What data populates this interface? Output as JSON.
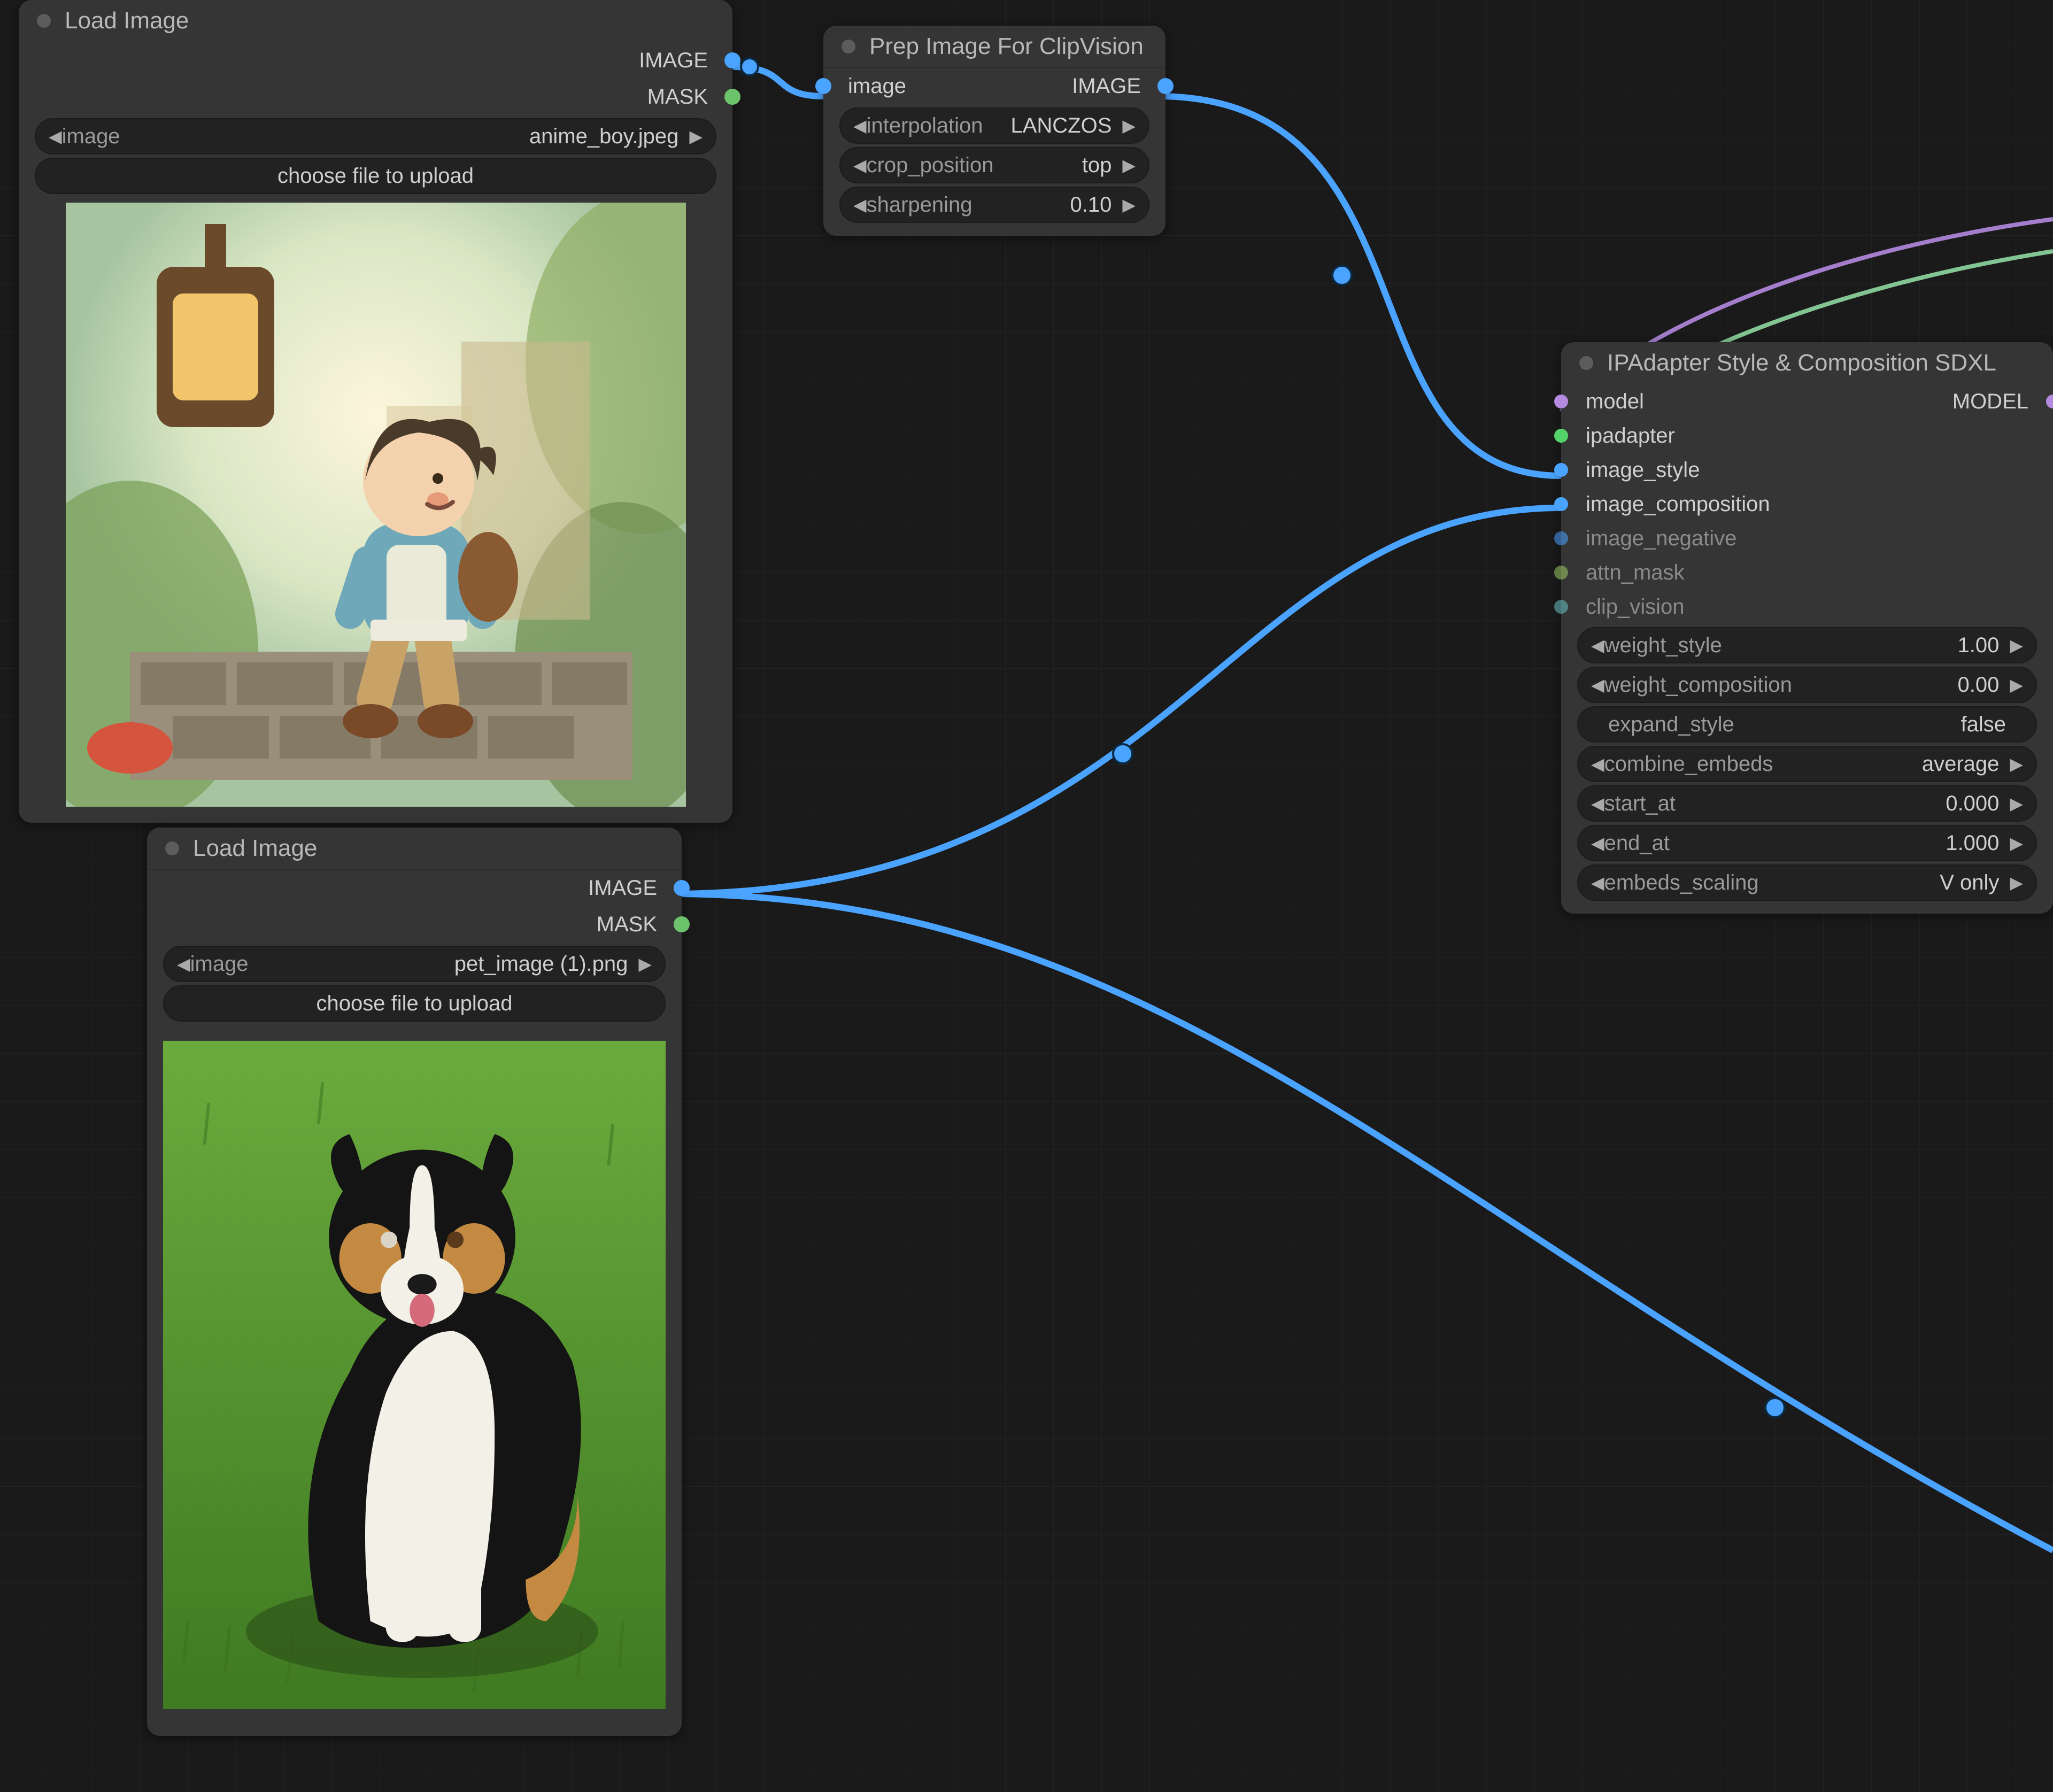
{
  "nodes": {
    "load1": {
      "title": "Load Image",
      "outputs": {
        "image": "IMAGE",
        "mask": "MASK"
      },
      "widgets": {
        "image_label": "image",
        "image_value": "anime_boy.jpeg",
        "upload": "choose file to upload"
      }
    },
    "load2": {
      "title": "Load Image",
      "outputs": {
        "image": "IMAGE",
        "mask": "MASK"
      },
      "widgets": {
        "image_label": "image",
        "image_value": "pet_image (1).png",
        "upload": "choose file to upload"
      }
    },
    "prep": {
      "title": "Prep Image For ClipVision",
      "in": {
        "image": "image"
      },
      "out": {
        "image": "IMAGE"
      },
      "widgets": {
        "interp_label": "interpolation",
        "interp_value": "LANCZOS",
        "crop_label": "crop_position",
        "crop_value": "top",
        "sharp_label": "sharpening",
        "sharp_value": "0.10"
      }
    },
    "ipa": {
      "title": "IPAdapter Style & Composition SDXL",
      "in": {
        "model": "model",
        "ipadapter": "ipadapter",
        "image_style": "image_style",
        "image_composition": "image_composition",
        "image_negative": "image_negative",
        "attn_mask": "attn_mask",
        "clip_vision": "clip_vision"
      },
      "out": {
        "model": "MODEL"
      },
      "widgets": {
        "ws_label": "weight_style",
        "ws_value": "1.00",
        "wc_label": "weight_composition",
        "wc_value": "0.00",
        "es_label": "expand_style",
        "es_value": "false",
        "ce_label": "combine_embeds",
        "ce_value": "average",
        "sa_label": "start_at",
        "sa_value": "0.000",
        "ea_label": "end_at",
        "ea_value": "1.000",
        "esc_label": "embeds_scaling",
        "esc_value": "V only"
      }
    }
  },
  "colors": {
    "image": "#4aa3ff",
    "mask": "#6cc36c",
    "model": "#b48ae0",
    "ipadapter": "#53d36a",
    "attn_mask": "#9ccc65",
    "clip_vision": "#6cc3c3"
  }
}
